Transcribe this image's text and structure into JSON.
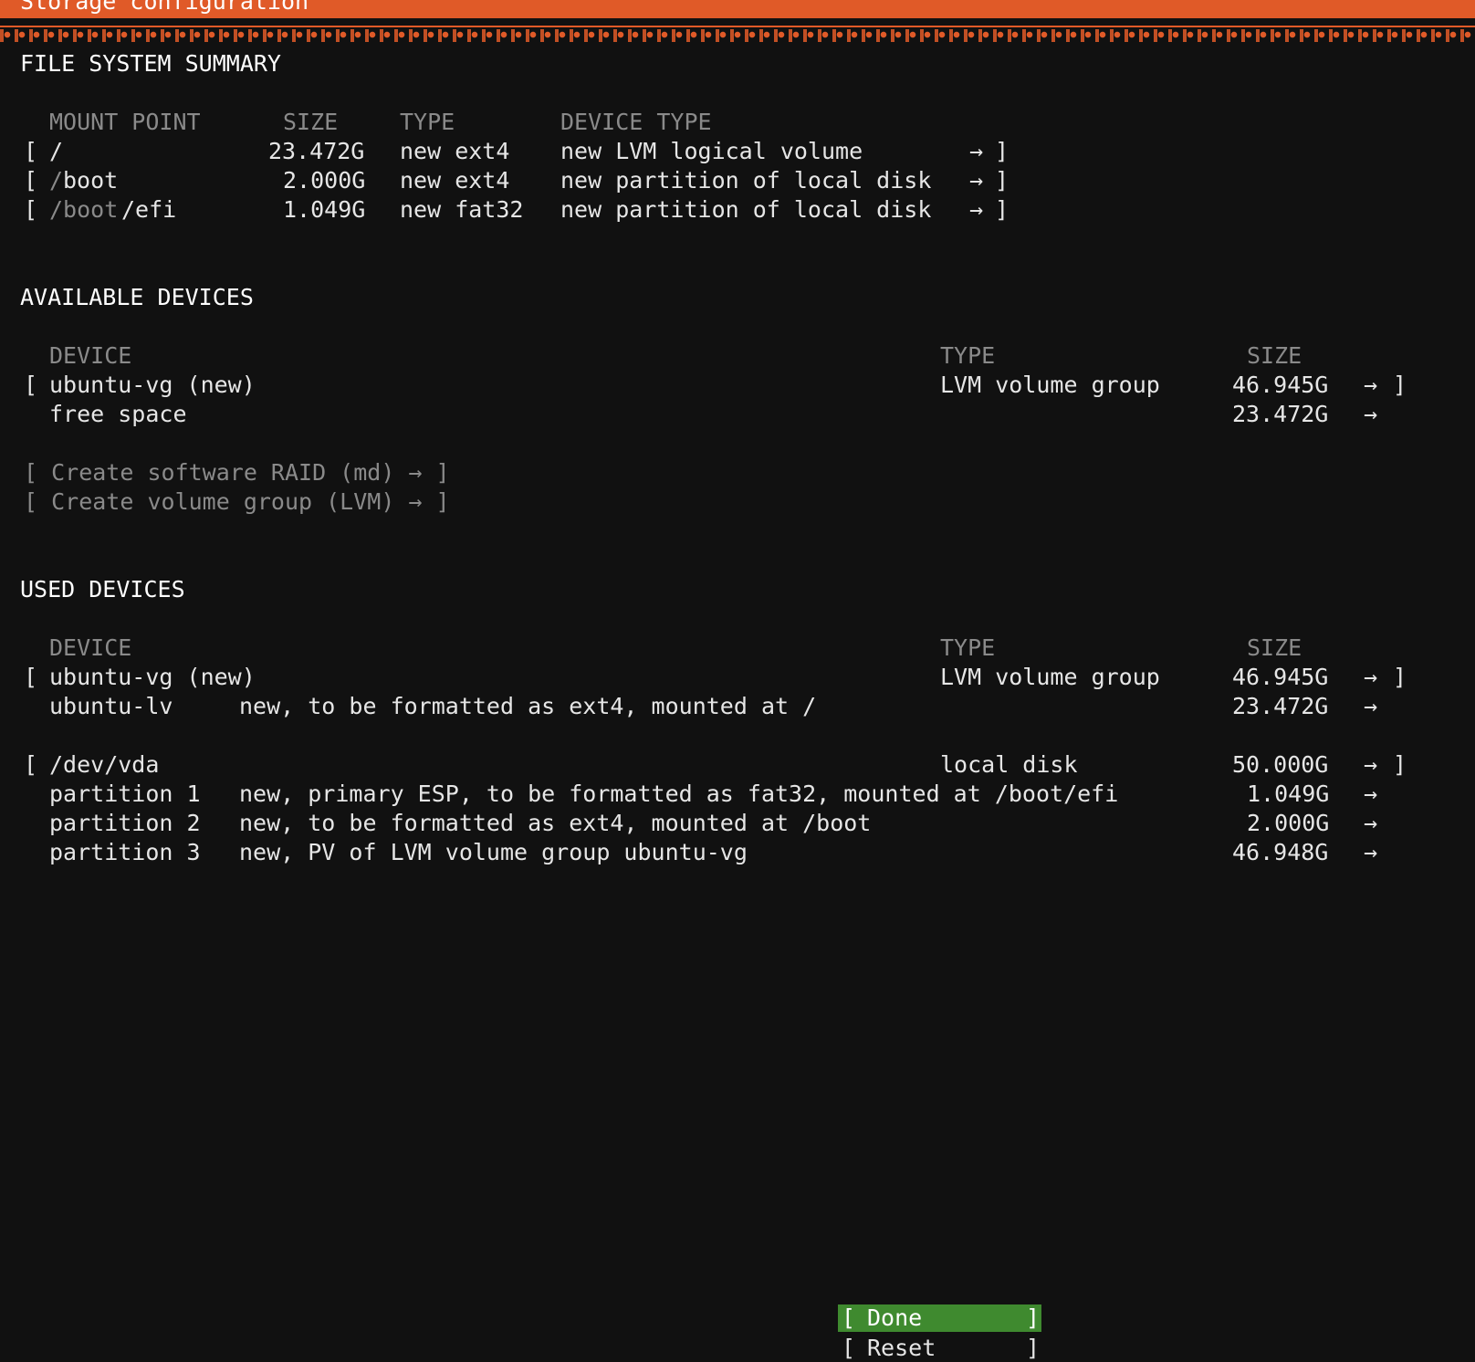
{
  "title": "Storage configuration",
  "fs_summary": {
    "heading": "FILE SYSTEM SUMMARY",
    "headers": {
      "mount": "MOUNT POINT",
      "size": "SIZE",
      "type": "TYPE",
      "device_type": "DEVICE TYPE"
    },
    "rows": [
      {
        "open": "[",
        "mount_a": "/",
        "mount_b": "",
        "size": "23.472G",
        "type": "new ext4",
        "device_type": "new LVM logical volume",
        "arrow": "→",
        "close": "]"
      },
      {
        "open": "[",
        "mount_a": "/",
        "mount_b": "boot",
        "size": "2.000G",
        "type": "new ext4",
        "device_type": "new partition of local disk",
        "arrow": "→",
        "close": "]"
      },
      {
        "open": "[",
        "mount_a": "/boot",
        "mount_b": "/efi",
        "size": "1.049G",
        "type": "new fat32",
        "device_type": "new partition of local disk",
        "arrow": "→",
        "close": "]"
      }
    ]
  },
  "available": {
    "heading": "AVAILABLE DEVICES",
    "headers": {
      "device": "DEVICE",
      "type": "TYPE",
      "size": "SIZE"
    },
    "rows": [
      {
        "open": "[",
        "device": "ubuntu-vg (new)",
        "type": "LVM volume group",
        "size": "46.945G",
        "arrow": "→",
        "close": "]"
      },
      {
        "device": "free space",
        "size": "23.472G",
        "arrow": "→"
      }
    ],
    "actions": [
      {
        "label": "[ Create software RAID (md) → ]"
      },
      {
        "label": "[ Create volume group (LVM) → ]"
      }
    ]
  },
  "used": {
    "heading": "USED DEVICES",
    "headers": {
      "device": "DEVICE",
      "type": "TYPE",
      "size": "SIZE"
    },
    "group1": [
      {
        "open": "[",
        "device": "ubuntu-vg (new)",
        "type": "LVM volume group",
        "size": "46.945G",
        "arrow": "→",
        "close": "]"
      },
      {
        "device": "ubuntu-lv",
        "desc": "new, to be formatted as ext4, mounted at /",
        "size": "23.472G",
        "arrow": "→"
      }
    ],
    "group2": [
      {
        "open": "[",
        "device": "/dev/vda",
        "type": "local disk",
        "size": "50.000G",
        "arrow": "→",
        "close": "]"
      },
      {
        "device": "partition 1",
        "desc": "new, primary ESP, to be formatted as fat32, mounted at /boot/efi",
        "size": "1.049G",
        "arrow": "→"
      },
      {
        "device": "partition 2",
        "desc": "new, to be formatted as ext4, mounted at /boot",
        "size": "2.000G",
        "arrow": "→"
      },
      {
        "device": "partition 3",
        "desc": "new, PV of LVM volume group ubuntu-vg",
        "size": "46.948G",
        "arrow": "→"
      }
    ]
  },
  "buttons": {
    "done_open": "[",
    "done": "Done",
    "done_close": "]",
    "reset_open": "[",
    "reset": "Reset",
    "reset_close": "]"
  }
}
